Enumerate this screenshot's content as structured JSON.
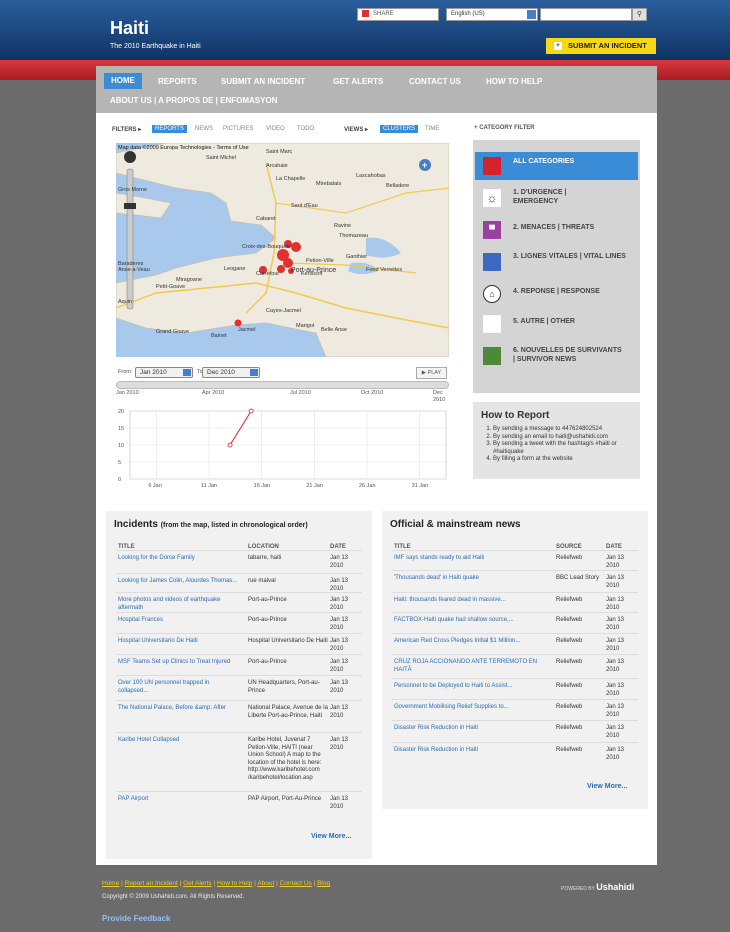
{
  "header": {
    "title": "Haiti",
    "subtitle": "The 2010 Earthquake in Haiti",
    "share_label": "SHARE",
    "language": "English (US)",
    "submit_btn": "SUBMIT AN INCIDENT"
  },
  "nav": {
    "items": [
      "HOME",
      "REPORTS",
      "SUBMIT AN INCIDENT",
      "GET ALERTS",
      "CONTACT US",
      "HOW TO HELP"
    ],
    "second_row": "ABOUT US | A PROPOS DE | ENFOMASYON"
  },
  "filters": {
    "label": "FILTERS",
    "items": [
      "REPORTS",
      "NEWS",
      "PICTURES",
      "VIDEO",
      "TODO"
    ],
    "views_label": "VIEWS",
    "views": [
      "CLUSTERS",
      "TIME"
    ]
  },
  "map": {
    "attribution": "Map data ©2009 Europa Technologies - Terms of Use",
    "places": [
      "Port-au-Prince",
      "Leogane",
      "Petit-Goave",
      "Croix-des-Bouquets",
      "Carrefour",
      "Kenscoff",
      "Jacmel",
      "Miragoane",
      "La Chapelle",
      "Saint Marc",
      "Mirebalais",
      "Grand Goave",
      "Belle Anse",
      "Fond Verrettes",
      "Thomazeau",
      "Ganthier",
      "Ravine",
      "Belladere",
      "Lascahobas",
      "Saut d'Eau",
      "Arcahaie",
      "Cabaret",
      "Aquin",
      "Cayes-Jacmel",
      "Petion-Ville",
      "Anse-a-Veau",
      "Baraderes",
      "Saint Michel",
      "Gros Morne",
      "Bainet",
      "Marigot"
    ]
  },
  "timeline": {
    "from_label": "From:",
    "from_value": "Jan 2010",
    "to_label": "To:",
    "to_value": "Dec 2010",
    "play": "PLAY",
    "ticks": [
      "Jan 2010",
      "Apr 2010",
      "Jul 2010",
      "Oct 2010",
      "Dec 2010"
    ],
    "chart_data": {
      "type": "line",
      "x": [
        "13 Jan",
        "14 Jan",
        "15 Jan"
      ],
      "values": [
        10,
        20
      ],
      "ylim": [
        0,
        20
      ],
      "yticks": [
        0,
        5,
        10,
        15,
        20
      ],
      "xticks": [
        "6 Jan",
        "11 Jan",
        "16 Jan",
        "21 Jan",
        "26 Jan",
        "31 Jan"
      ]
    }
  },
  "category_filter": {
    "heading": "CATEGORY FILTER",
    "items": [
      {
        "label": "ALL CATEGORIES",
        "color": "#d2232a"
      },
      {
        "label": "1. D'URGENCE | EMERGENCY",
        "color": "#ffffff",
        "icon": "gear-icon"
      },
      {
        "label": "2. MENACES | THREATS",
        "color": "#9b3fa3",
        "icon": "bus-icon"
      },
      {
        "label": "3. LIGNES VITALES | VITAL LINES",
        "color": "#3d68c2"
      },
      {
        "label": "4. REPONSE | RESPONSE",
        "color": "#ffffff",
        "icon": "tent-icon"
      },
      {
        "label": "5. AUTRE | OTHER",
        "color": "#ffffff"
      },
      {
        "label": "6. NOUVELLES DE SURVIVANTS | SURVIVOR NEWS",
        "color": "#4c8a3a"
      }
    ]
  },
  "how_to_report": {
    "title": "How to Report",
    "steps": [
      "By sending a message to 447624802524",
      "By sending an email to haiti@ushahidi.com",
      "By sending a tweet with the hashtag/s #haiti or #haitiquake",
      "By filling a form at the website"
    ]
  },
  "incidents": {
    "title": "Incidents",
    "title_note": "(from the map, listed in chronological order)",
    "headers": [
      "TITLE",
      "LOCATION",
      "DATE"
    ],
    "rows": [
      {
        "title": "Looking for the Dorce Family",
        "location": "tabarre, haiti",
        "date": "Jan 13 2010"
      },
      {
        "title": "Looking for James Colin, Alourdes Thomas...",
        "location": "rue malval",
        "date": "Jan 13 2010"
      },
      {
        "title": "More photos and videos of earthquake aftermath",
        "location": "Port-au-Prince",
        "date": "Jan 13 2010"
      },
      {
        "title": "Hospital Frances",
        "location": "Port-au-Prince",
        "date": "Jan 13 2010"
      },
      {
        "title": "Hospital Universitario De Haiti",
        "location": "Hospital Universitario De Haiti",
        "date": "Jan 13 2010"
      },
      {
        "title": "MSF Teams Set up Clinics to Treat Injured",
        "location": "Port-au-Prince",
        "date": "Jan 13 2010"
      },
      {
        "title": "Over 100 UN personnel trapped in collapsed...",
        "location": "UN Headquarters, Port-au-Prince",
        "date": "Jan 13 2010"
      },
      {
        "title": "The National Palace, Before &amp; After",
        "location": "National Palace, Avenue de la Liberte Port-au-Prince, Haiti",
        "date": "Jan 13 2010"
      },
      {
        "title": "Karibe Hotel Collapsed",
        "location": "Karibe Hotel, Juvenat 7 Petion-Ville, HAITI (near Union School) A map to the location of the hotel is here: http://www.karibehotel.com /karibehotel/location.asp",
        "date": "Jan 13 2010"
      },
      {
        "title": "PAP Airport",
        "location": "PAP Airport, Port-Au-Prince",
        "date": "Jan 13 2010"
      }
    ],
    "more": "View More..."
  },
  "news": {
    "title": "Official & mainstream news",
    "headers": [
      "TITLE",
      "SOURCE",
      "DATE"
    ],
    "rows": [
      {
        "title": "IMF says stands ready to aid Haiti",
        "source": "Reliefweb",
        "date": "Jan 13 2010"
      },
      {
        "title": "'Thousands dead' in Haiti quake",
        "source": "BBC Lead Story",
        "date": "Jan 13 2010"
      },
      {
        "title": "Haiti: thousands feared dead in massive...",
        "source": "Reliefweb",
        "date": "Jan 13 2010"
      },
      {
        "title": "FACTBOX-Haiti quake had shallow source,...",
        "source": "Reliefweb",
        "date": "Jan 13 2010"
      },
      {
        "title": "American Red Cross Pledges Initial $1 Million...",
        "source": "Reliefweb",
        "date": "Jan 13 2010"
      },
      {
        "title": "CRUZ ROJA ACCIONANDO ANTE TERREMOTO EN HAITÃ",
        "source": "Reliefweb",
        "date": "Jan 13 2010"
      },
      {
        "title": "Personnel to be Deployed to Haiti to Assist...",
        "source": "Reliefweb",
        "date": "Jan 13 2010"
      },
      {
        "title": "Government Mobilising Relief Supplies to...",
        "source": "Reliefweb",
        "date": "Jan 13 2010"
      },
      {
        "title": "Disaster Risk Reduction in Haiti",
        "source": "Reliefweb",
        "date": "Jan 13 2010"
      },
      {
        "title": "Disaster Risk Reduction in Haiti",
        "source": "Reliefweb",
        "date": "Jan 13 2010"
      }
    ],
    "more": "View More..."
  },
  "footer": {
    "links": [
      "Home",
      "Report an Incident",
      "Get Alerts",
      "How to Help",
      "About",
      "Contact Us",
      "Blog"
    ],
    "copyright": "Copyright © 2009 Ushahidi.com. All Rights Reserved.",
    "feedback": "Provide Feedback",
    "powered": "POWERED BY",
    "brand": "Ushahidi"
  }
}
